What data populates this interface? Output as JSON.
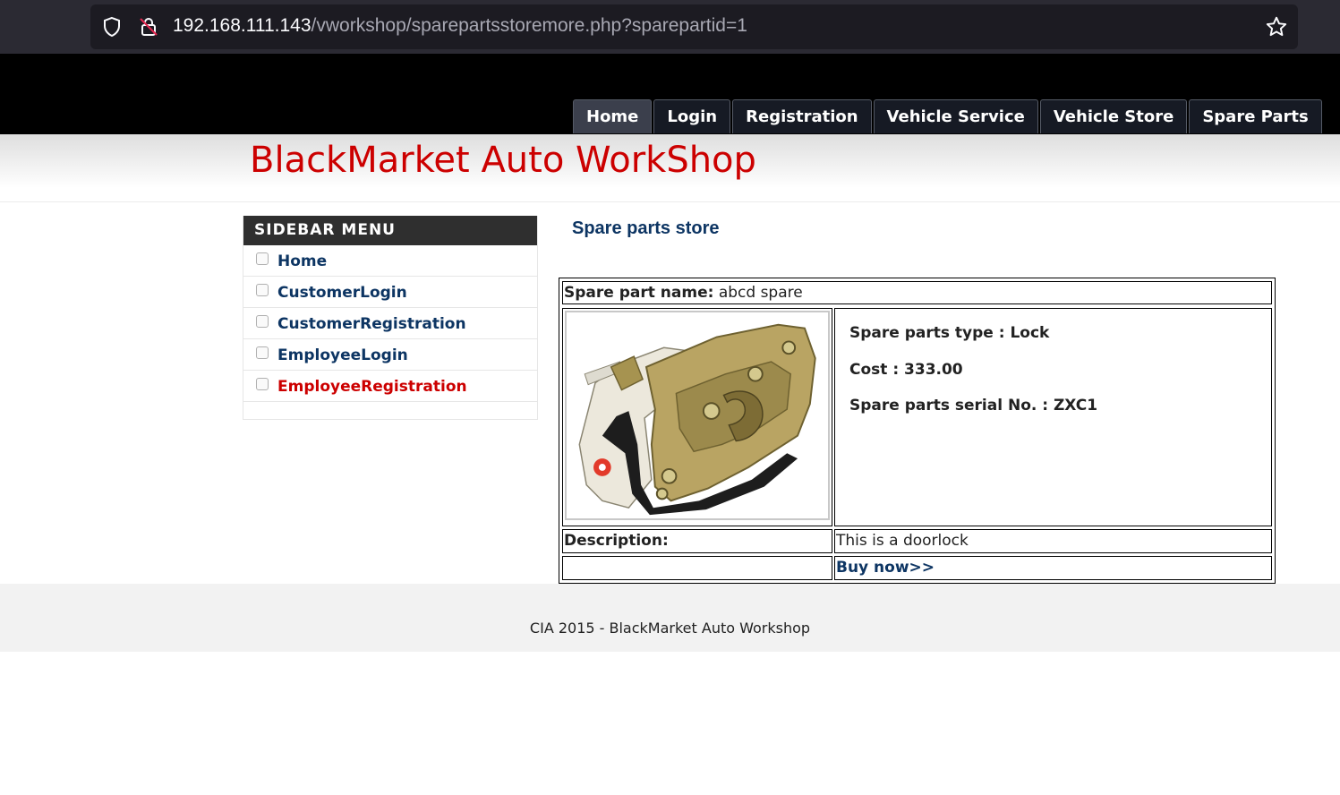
{
  "browser": {
    "url_host": "192.168.111.143",
    "url_path": "/vworkshop/sparepartsstoremore.php?sparepartid=1",
    "icons": [
      "shield-icon",
      "lock-icon",
      "star-icon"
    ]
  },
  "nav": {
    "items": [
      "Home",
      "Login",
      "Registration",
      "Vehicle Service",
      "Vehicle Store",
      "Spare Parts"
    ]
  },
  "site": {
    "title": "BlackMarket Auto WorkShop"
  },
  "sidebar": {
    "heading": "SIDEBAR MENU",
    "items": [
      {
        "label": "Home"
      },
      {
        "label": "CustomerLogin"
      },
      {
        "label": "CustomerRegistration"
      },
      {
        "label": "EmployeeLogin"
      },
      {
        "label": "EmployeeRegistration"
      }
    ]
  },
  "main": {
    "heading": "Spare parts store",
    "part": {
      "name_label": "Spare part name:",
      "name_value": "abcd spare",
      "type_line": "Spare parts type : Lock",
      "cost_line": "Cost : 333.00",
      "serial_line": "Spare parts serial No. : ZXC1",
      "description_label": "Description:",
      "description_value": "This is a doorlock",
      "buy_link": "Buy now>>"
    }
  },
  "footer": {
    "text": "CIA 2015 - BlackMarket Auto Workshop"
  },
  "colors": {
    "title_red": "#cc0000",
    "link_blue": "#0d3563",
    "header_black": "#000000"
  }
}
